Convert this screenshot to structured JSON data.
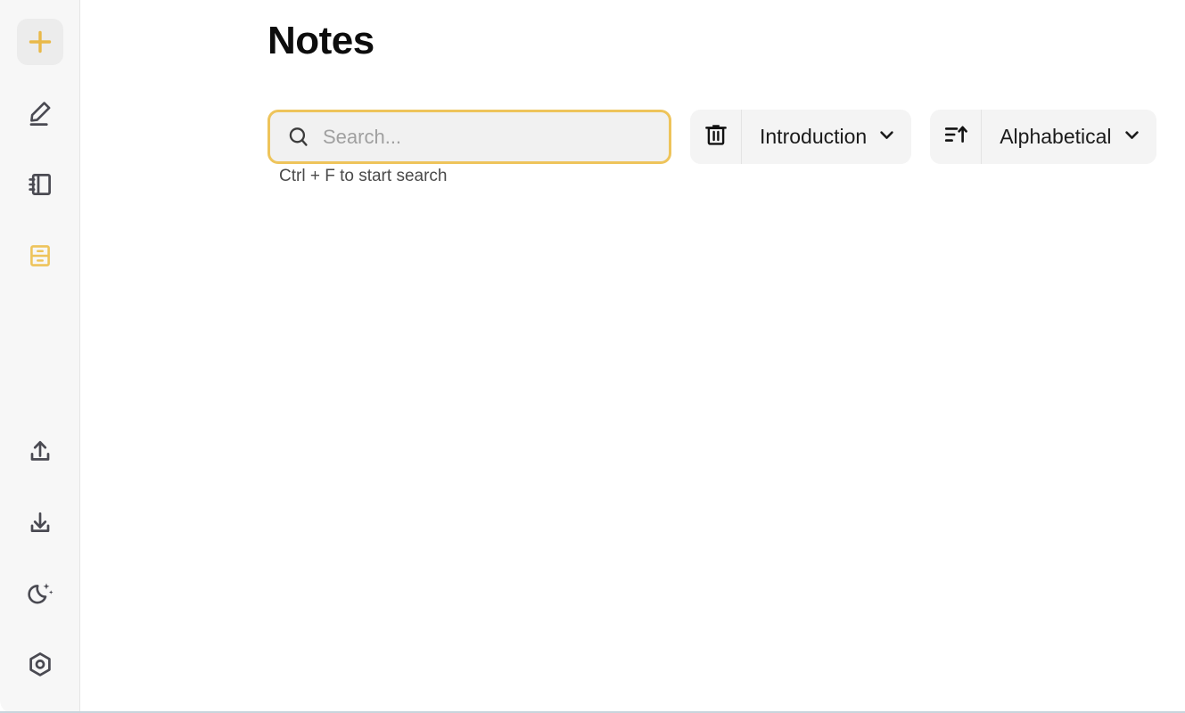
{
  "app": {
    "accent_color": "#eec45b",
    "sidebar_bg": "#f7f7f7",
    "main_bg": "#ffffff"
  },
  "sidebar": {
    "top_items": [
      {
        "id": "new-note",
        "icon": "plus-icon",
        "label": "New Note",
        "color": "#e9b949",
        "active": true
      },
      {
        "id": "edit",
        "icon": "pencil-edit-icon",
        "label": "Edit",
        "color": "#4a4a52",
        "active": false
      },
      {
        "id": "notebook",
        "icon": "notebook-icon",
        "label": "Notebook",
        "color": "#4a4a52",
        "active": false
      },
      {
        "id": "archive",
        "icon": "file-cabinet-icon",
        "label": "Archive",
        "color": "#eec45b",
        "active": false
      }
    ],
    "bottom_items": [
      {
        "id": "upload",
        "icon": "upload-icon",
        "label": "Upload",
        "color": "#4a4a52"
      },
      {
        "id": "download",
        "icon": "download-icon",
        "label": "Download",
        "color": "#4a4a52"
      },
      {
        "id": "dark-mode",
        "icon": "moon-stars-icon",
        "label": "Dark Mode",
        "color": "#4a4a52"
      },
      {
        "id": "settings",
        "icon": "hexagon-settings-icon",
        "label": "Settings",
        "color": "#4a4a52"
      }
    ]
  },
  "main": {
    "title": "Notes"
  },
  "search": {
    "icon": "search-icon",
    "value": "",
    "placeholder": "Search...",
    "hint": "Ctrl + F to start search"
  },
  "filter": {
    "icon": "trash-icon",
    "icon_label": "Delete",
    "selected": "Introduction",
    "chevron": "chevron-down-icon",
    "options": [
      "Introduction"
    ]
  },
  "sort": {
    "icon": "sort-ascending-icon",
    "icon_label": "Sort direction",
    "selected": "Alphabetical",
    "chevron": "chevron-down-icon",
    "options": [
      "Alphabetical"
    ]
  }
}
